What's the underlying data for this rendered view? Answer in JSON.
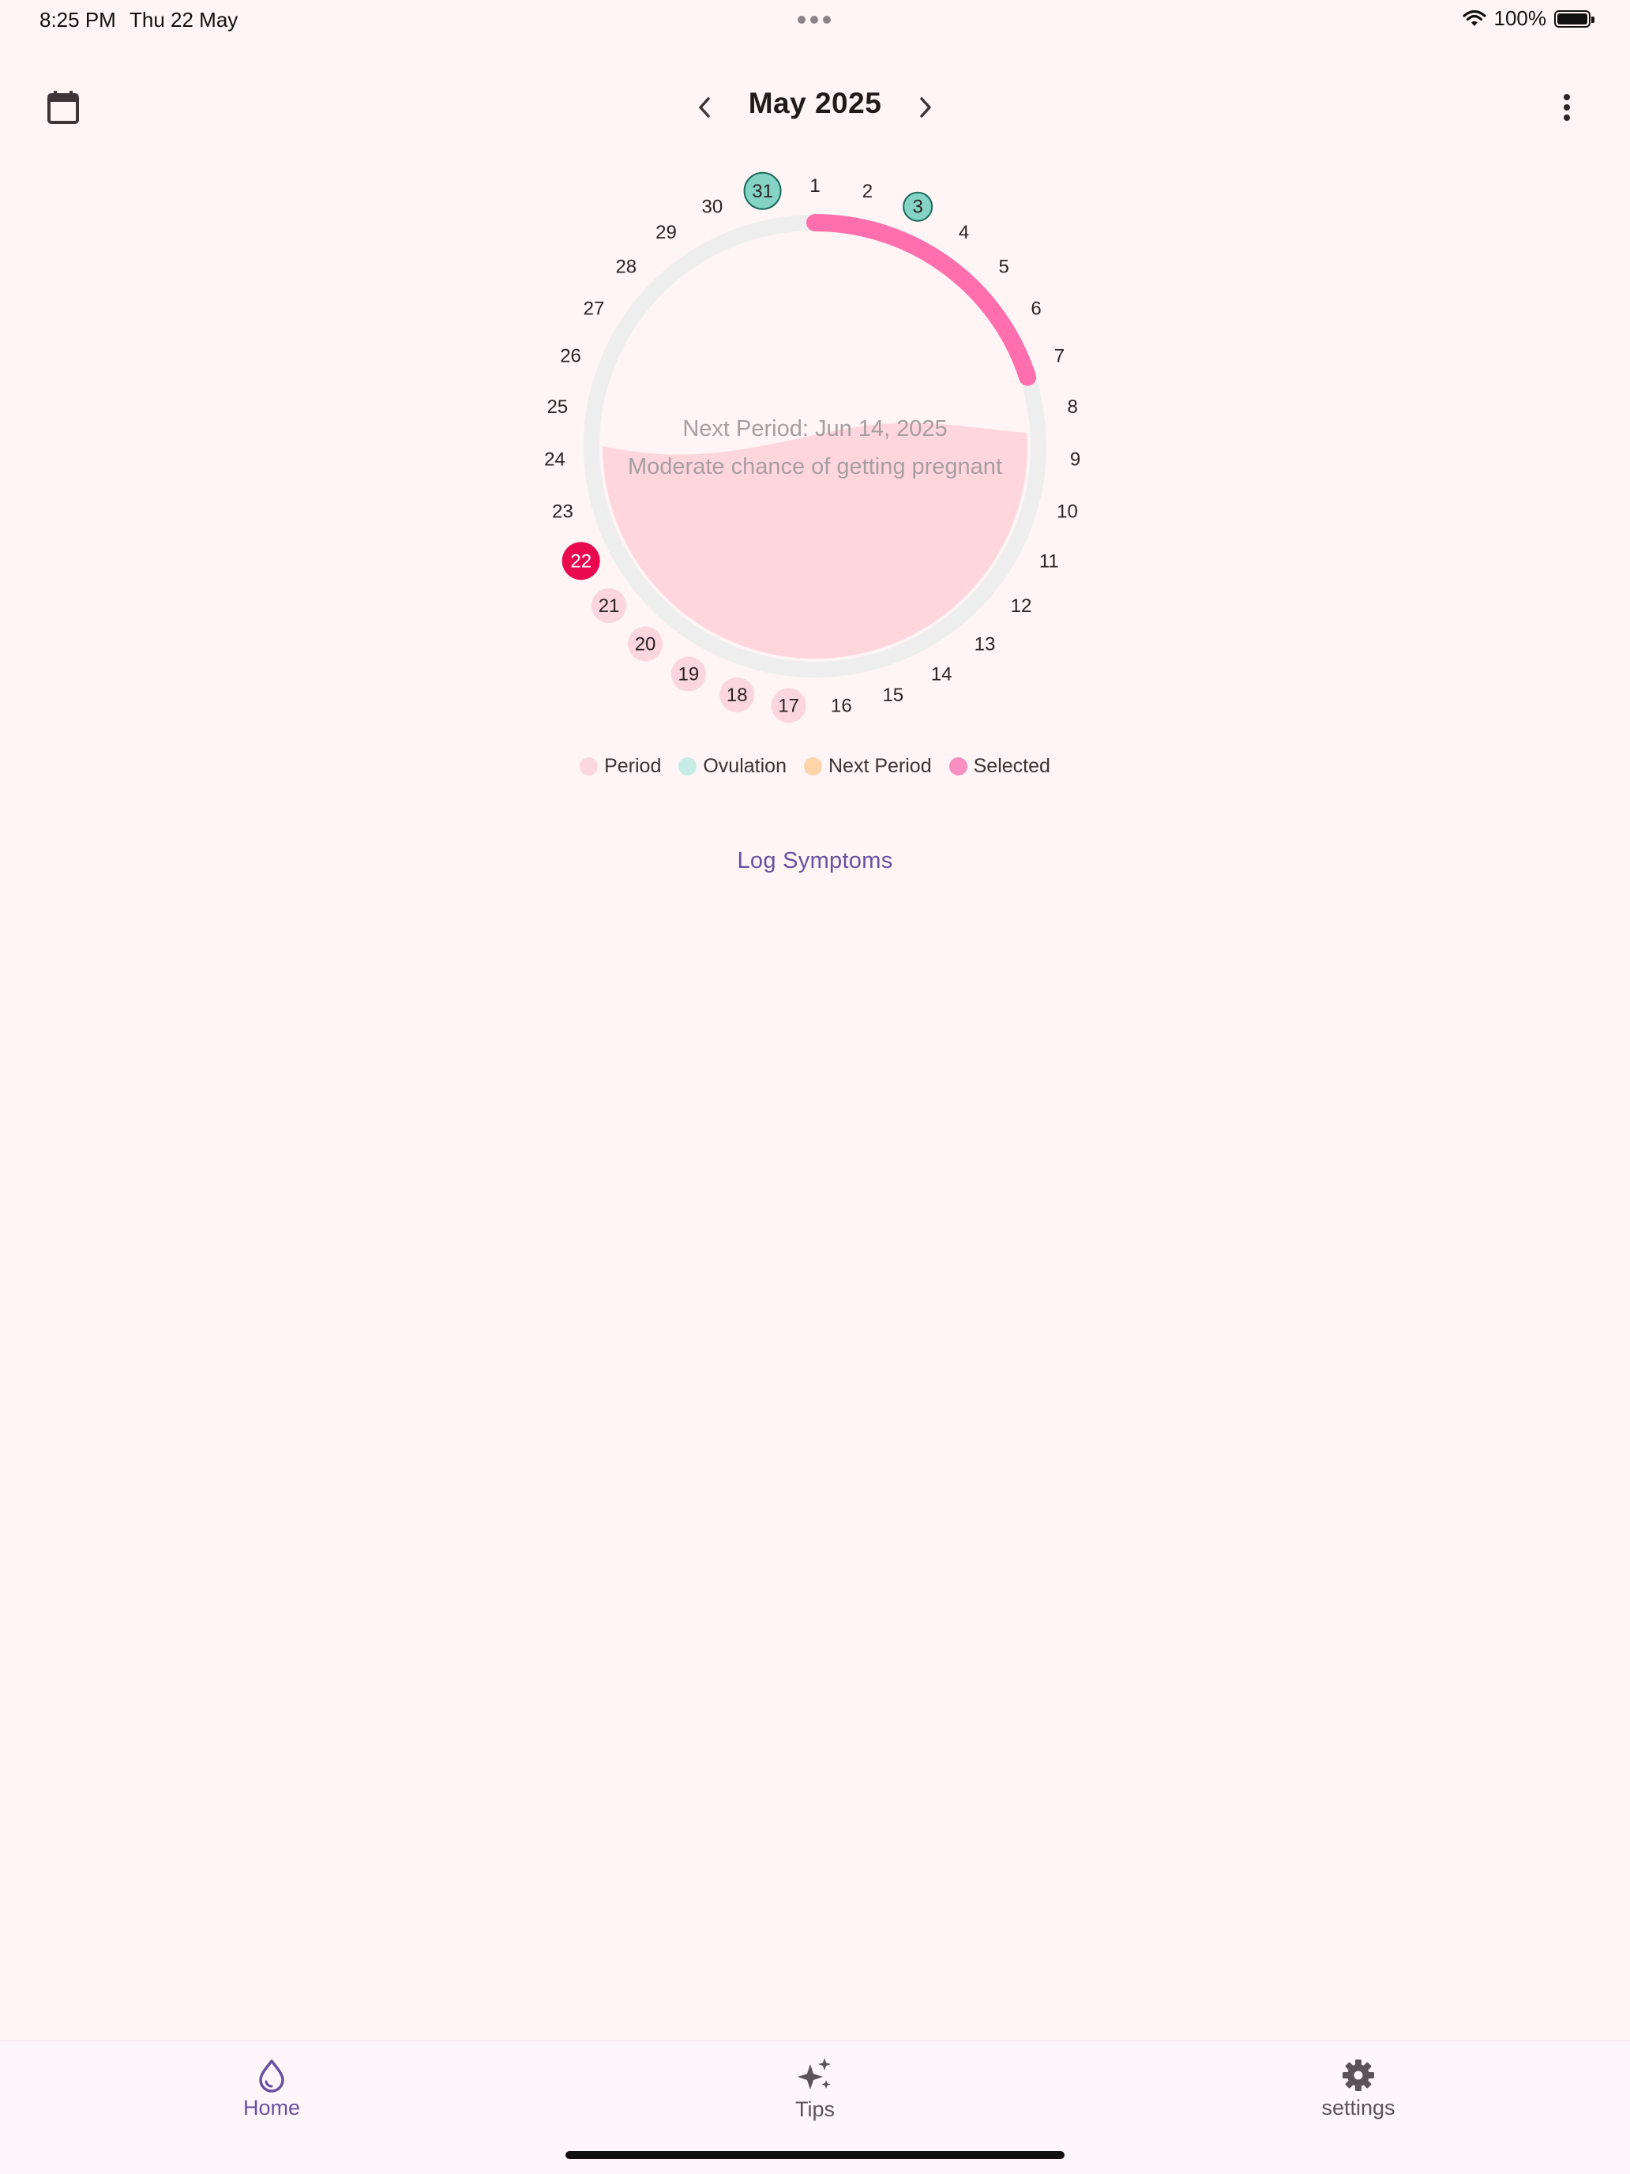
{
  "status_bar": {
    "time": "8:25 PM",
    "date": "Thu 22 May",
    "battery": "100%"
  },
  "header": {
    "title": "May 2025",
    "icons": [
      "calendar-icon",
      "chevron-left-icon",
      "chevron-right-icon",
      "more-vert-icon"
    ]
  },
  "cycle": {
    "days": [
      "1",
      "2",
      "3",
      "4",
      "5",
      "6",
      "7",
      "8",
      "9",
      "10",
      "11",
      "12",
      "13",
      "14",
      "15",
      "16",
      "17",
      "18",
      "19",
      "20",
      "21",
      "22",
      "23",
      "24",
      "25",
      "26",
      "27",
      "28",
      "29",
      "30",
      "31"
    ],
    "selected_day": "22",
    "period_days": [
      "17",
      "18",
      "19",
      "20",
      "21"
    ],
    "ovulation_days": [
      "31",
      "3"
    ],
    "next_period_text": "Next Period: Jun 14, 2025",
    "chance_text": "Moderate chance of getting pregnant",
    "progress_fraction": 0.2,
    "colors": {
      "period": "#fcd6df",
      "ovulation": "#84d3c4",
      "selected": "#e8094f",
      "progress": "#ff6fad",
      "track": "#eeeeee",
      "fill": "#ffd6de"
    }
  },
  "legend": [
    {
      "label": "Period",
      "color": "#fdd7df"
    },
    {
      "label": "Ovulation",
      "color": "#c6ece5"
    },
    {
      "label": "Next Period",
      "color": "#fdd5a8"
    },
    {
      "label": "Selected",
      "color": "#f98fc0"
    }
  ],
  "actions": {
    "log_symptoms": "Log Symptoms"
  },
  "nav": [
    {
      "label": "Home",
      "icon": "drop-icon",
      "active": true
    },
    {
      "label": "Tips",
      "icon": "sparkle-icon",
      "active": false
    },
    {
      "label": "settings",
      "icon": "gear-icon",
      "active": false
    }
  ]
}
